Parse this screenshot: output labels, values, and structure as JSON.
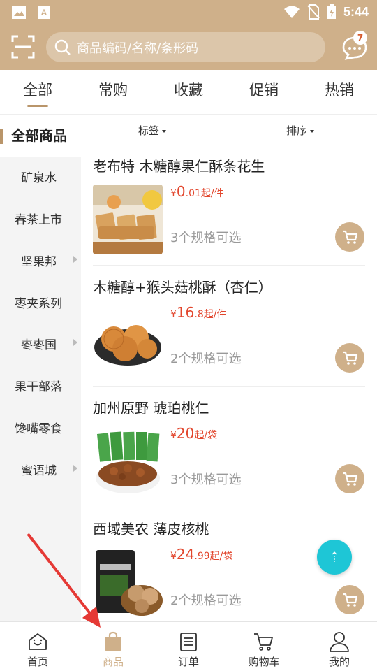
{
  "status_bar": {
    "time": "5:44"
  },
  "header": {
    "search_placeholder": "商品编码/名称/条形码",
    "message_badge": "7"
  },
  "tabs": [
    {
      "label": "全部",
      "active": true
    },
    {
      "label": "常购",
      "active": false
    },
    {
      "label": "收藏",
      "active": false
    },
    {
      "label": "促销",
      "active": false
    },
    {
      "label": "热销",
      "active": false
    }
  ],
  "filters": {
    "tag_label": "标签",
    "sort_label": "排序"
  },
  "sidebar": {
    "header": "全部商品",
    "items": [
      {
        "label": "矿泉水",
        "has_sub": false
      },
      {
        "label": "春茶上市",
        "has_sub": false
      },
      {
        "label": "坚果邦",
        "has_sub": true
      },
      {
        "label": "枣夹系列",
        "has_sub": false
      },
      {
        "label": "枣枣国",
        "has_sub": true
      },
      {
        "label": "果干部落",
        "has_sub": false
      },
      {
        "label": "馋嘴零食",
        "has_sub": false
      },
      {
        "label": "蜜语城",
        "has_sub": true
      }
    ]
  },
  "products": [
    {
      "title": "老布特 木糖醇果仁酥条花生",
      "yen": "¥",
      "price_int": "0",
      "price_dec": ".01",
      "unit": "起/件",
      "spec": "3个规格可选"
    },
    {
      "title": "木糖醇+猴头菇桃酥（杏仁）",
      "yen": "¥",
      "price_int": "16",
      "price_dec": ".8",
      "unit": "起/件",
      "spec": "2个规格可选"
    },
    {
      "title": "加州原野 琥珀桃仁",
      "yen": "¥",
      "price_int": "20",
      "price_dec": "",
      "unit": "起/袋",
      "spec": "3个规格可选"
    },
    {
      "title": "西域美农 薄皮核桃",
      "yen": "¥",
      "price_int": "24",
      "price_dec": ".99",
      "unit": "起/袋",
      "spec": "2个规格可选"
    }
  ],
  "bottom_nav": [
    {
      "label": "首页",
      "icon": "home-icon",
      "active": false
    },
    {
      "label": "商品",
      "icon": "bag-icon",
      "active": true
    },
    {
      "label": "订单",
      "icon": "order-icon",
      "active": false
    },
    {
      "label": "购物车",
      "icon": "cart-icon",
      "active": false
    },
    {
      "label": "我的",
      "icon": "user-icon",
      "active": false
    }
  ],
  "colors": {
    "brand": "#cfb08a",
    "price": "#e2462d",
    "fab": "#1ec6d6"
  }
}
